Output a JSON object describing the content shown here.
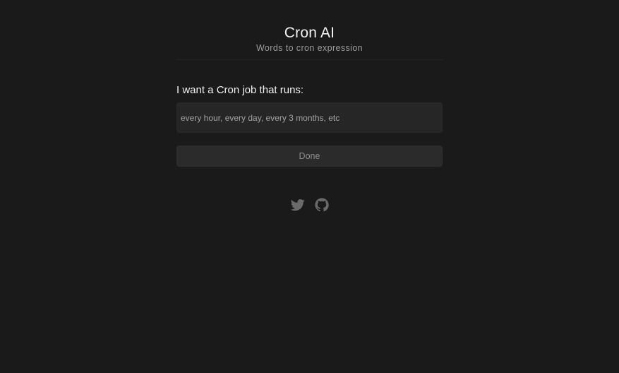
{
  "header": {
    "title": "Cron AI",
    "subtitle": "Words to cron expression"
  },
  "form": {
    "label": "I want a Cron job that runs:",
    "input_value": "",
    "input_placeholder": "every hour, every day, every 3 months, etc",
    "submit_label": "Done"
  },
  "footer": {
    "icons": [
      "twitter-icon",
      "github-icon"
    ]
  },
  "colors": {
    "background": "#1a1a1a",
    "input_background": "#262626",
    "button_background": "#2b2b2b",
    "icon_color": "#6b6b6b"
  }
}
